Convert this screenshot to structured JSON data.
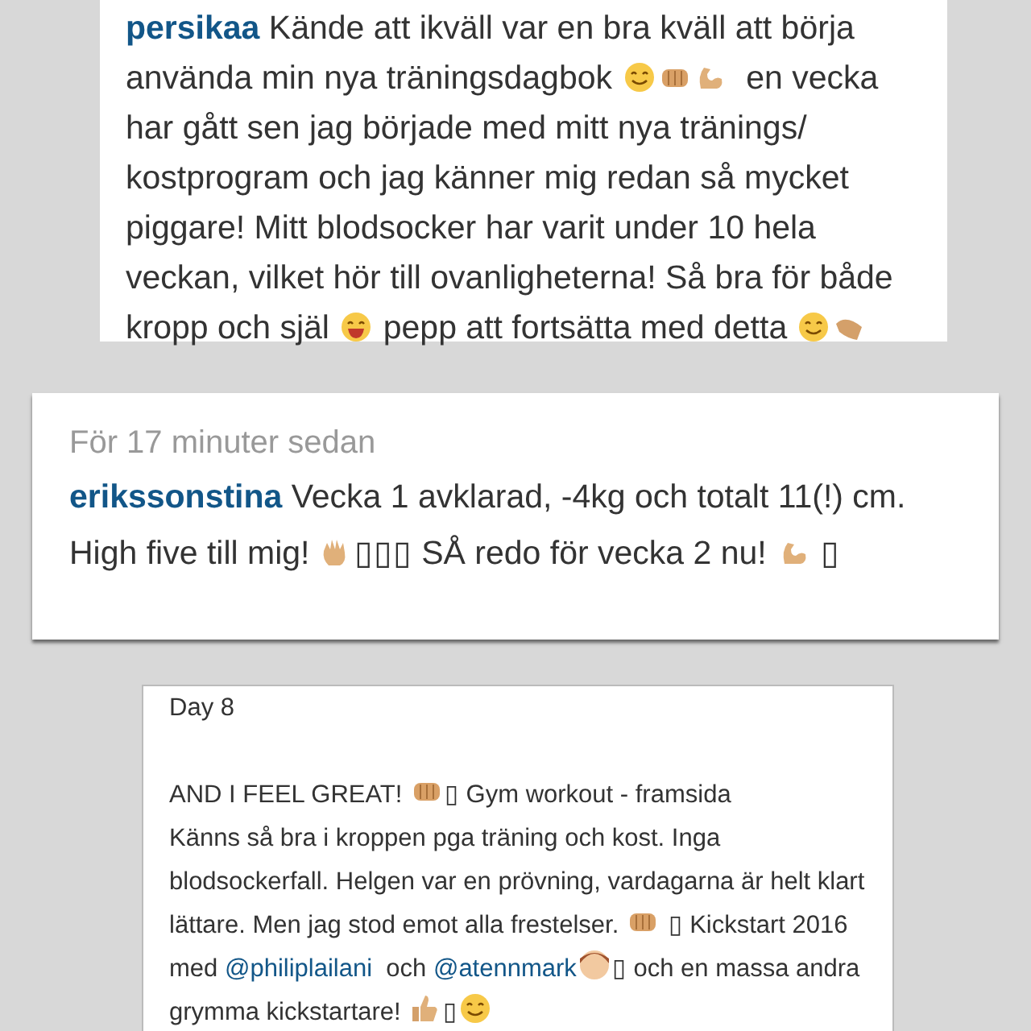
{
  "posts": [
    {
      "segments": [
        {
          "kind": "user",
          "text": "persikaa"
        },
        {
          "kind": "text",
          "text": " Kände att ikväll var en bra kväll att börja använda min nya träningsdagbok "
        },
        {
          "kind": "smile-emoji"
        },
        {
          "kind": "fist-emoji"
        },
        {
          "kind": "arm-emoji"
        },
        {
          "kind": "text",
          "text": "  en vecka har gått sen jag började med mitt nya tränings/ kostprogram och jag känner mig redan så mycket piggare! Mitt blodsocker har varit under 10 hela veckan, vilket hör till ovanligheterna! Så bra för både kropp och själ "
        },
        {
          "kind": "grin-emoji"
        },
        {
          "kind": "text",
          "text": " pepp att fortsätta med detta "
        },
        {
          "kind": "smile-emoji"
        },
        {
          "kind": "hands-emoji"
        }
      ]
    },
    {
      "timestamp": "För 17 minuter sedan",
      "segments": [
        {
          "kind": "user",
          "text": "erikssonstina"
        },
        {
          "kind": "text",
          "text": " Vecka 1 avklarad, -4kg och totalt 11(!) cm. High five till mig! "
        },
        {
          "kind": "wave-emoji"
        },
        {
          "kind": "text",
          "text": "▯▯▯ SÅ redo för vecka 2 nu! "
        },
        {
          "kind": "arm-emoji"
        },
        {
          "kind": "text",
          "text": " ▯"
        }
      ]
    },
    {
      "heading": "Day 8",
      "segments": [
        {
          "kind": "text",
          "text": "AND I FEEL GREAT! "
        },
        {
          "kind": "fist-emoji"
        },
        {
          "kind": "text",
          "text": "▯ Gym workout - framsida\nKänns så bra i kroppen pga träning och kost. Inga blodsockerfall. Helgen var en prövning, vardagarna är helt klart lättare. Men jag stod emot alla frestelser. "
        },
        {
          "kind": "fist-emoji"
        },
        {
          "kind": "text",
          "text": " ▯ Kickstart 2016 med "
        },
        {
          "kind": "mention",
          "text": "@philiplailani"
        },
        {
          "kind": "text",
          "text": "  och "
        },
        {
          "kind": "mention",
          "text": "@atennmark"
        },
        {
          "kind": "girl-emoji"
        },
        {
          "kind": "text",
          "text": "▯ och en massa andra grymma kickstartare! "
        },
        {
          "kind": "thumb-emoji"
        },
        {
          "kind": "text",
          "text": "▯"
        },
        {
          "kind": "smile-emoji"
        }
      ]
    }
  ]
}
